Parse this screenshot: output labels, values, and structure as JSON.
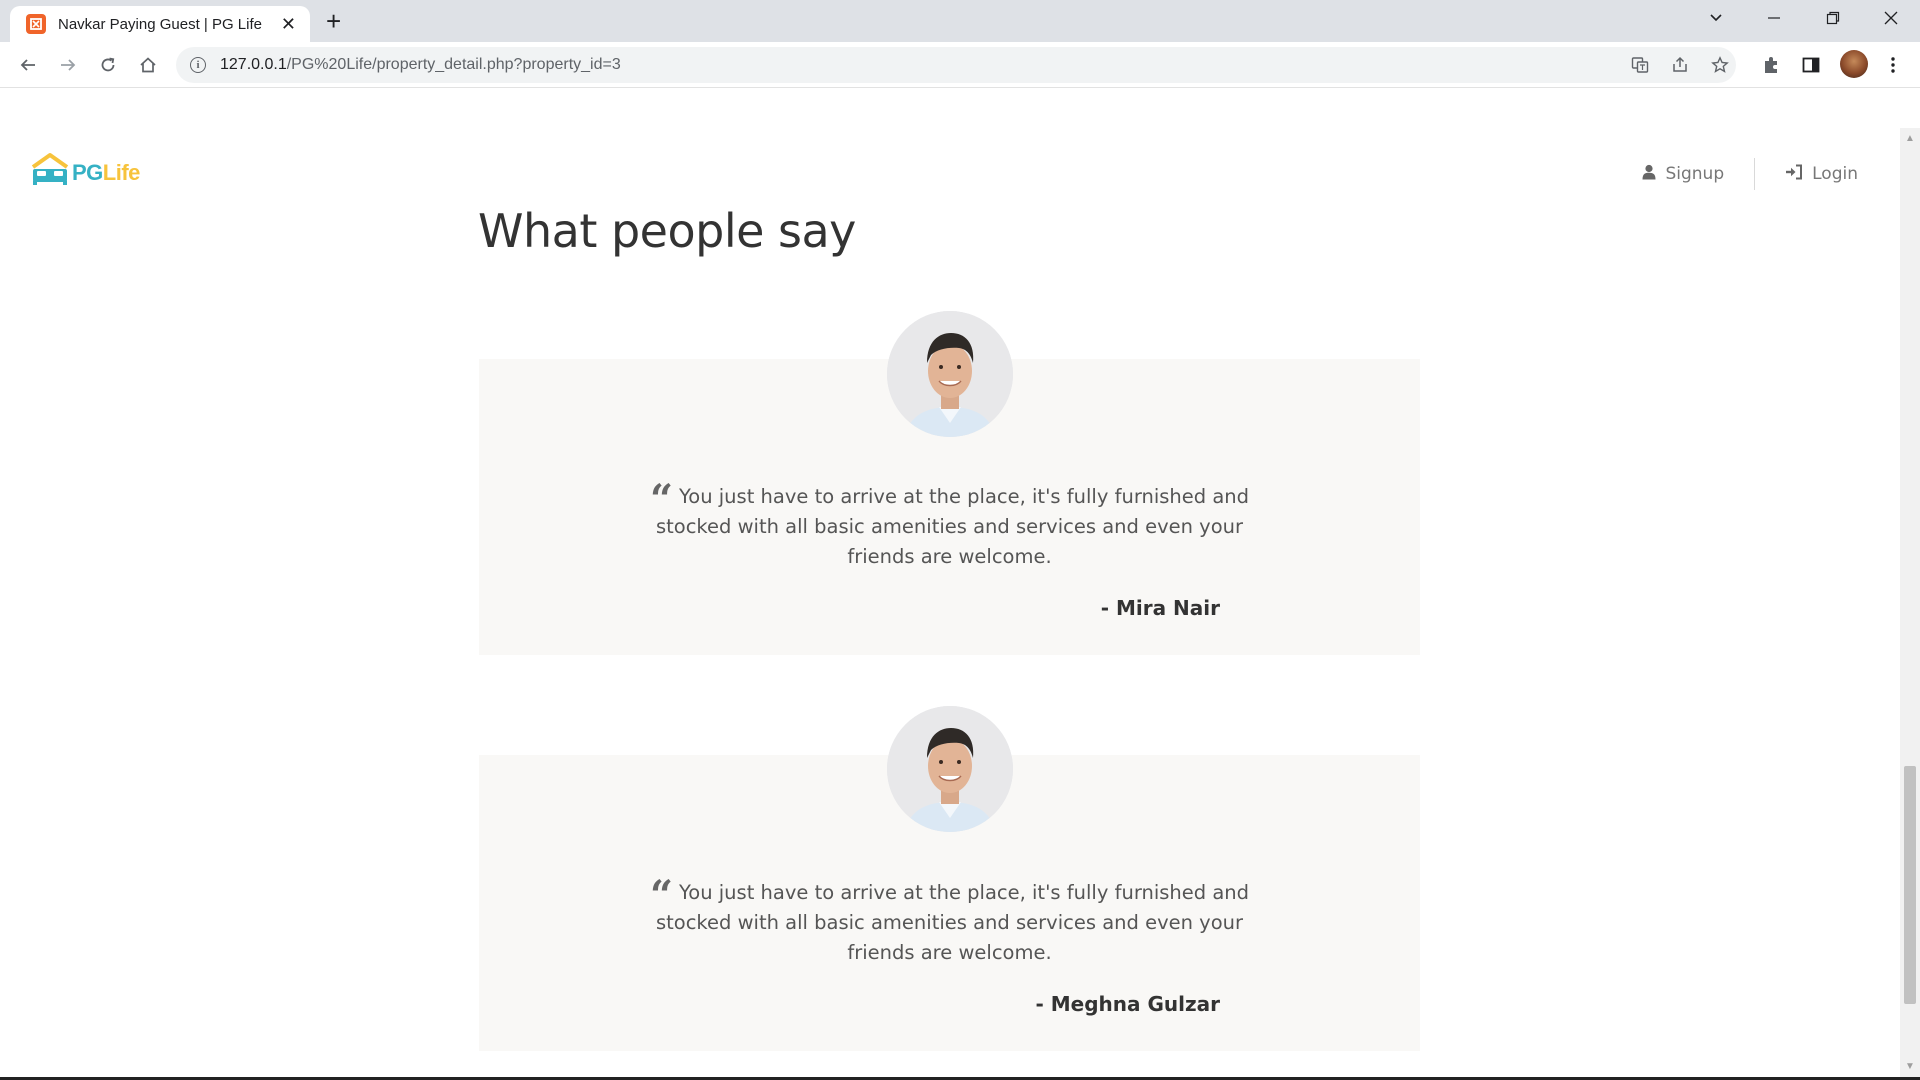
{
  "browser": {
    "tab_title": "Navkar Paying Guest | PG Life",
    "url_host": "127.0.0.1",
    "url_path": "/PG%20Life/property_detail.php?property_id=3",
    "new_tab_label": "+",
    "close_label": "✕"
  },
  "site": {
    "logo_pg": "PG",
    "logo_life": "Life",
    "nav": {
      "signup": "Signup",
      "login": "Login"
    }
  },
  "section": {
    "title": "What people say"
  },
  "testimonials": [
    {
      "quote": "You just have to arrive at the place, it's fully furnished and stocked with all basic amenities and services and even your friends are welcome.",
      "author": "- Mira Nair"
    },
    {
      "quote": "You just have to arrive at the place, it's fully furnished and stocked with all basic amenities and services and even your friends are welcome.",
      "author": "- Meghna Gulzar"
    }
  ],
  "colors": {
    "brand_teal": "#35b1c4",
    "brand_yellow": "#f7c33c",
    "card_bg": "#f9f8f6"
  },
  "icons": [
    "favicon-icon",
    "back-icon",
    "forward-icon",
    "reload-icon",
    "home-icon",
    "info-icon",
    "translate-icon",
    "share-icon",
    "star-icon",
    "extensions-icon",
    "sidepanel-icon",
    "menu-icon",
    "user-icon",
    "login-icon",
    "quote-icon"
  ]
}
